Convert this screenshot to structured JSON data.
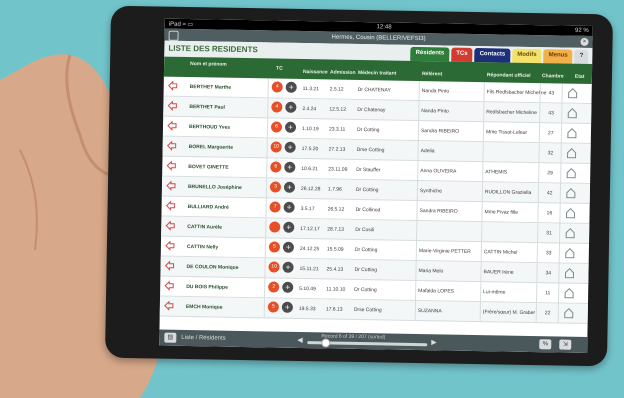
{
  "status": {
    "left": "iPad ≈ ▭",
    "time": "12:48",
    "battery": "92 %"
  },
  "app_title": "Hermes, Cousin (BELLERIVEFSI3)",
  "page_title": "LISTE DES RESIDENTS",
  "tabs": [
    "Résidents",
    "TCs",
    "Contacts",
    "Modifs",
    "Menus",
    "?"
  ],
  "columns": {
    "nom": "Nom et prénom",
    "tc": "TC",
    "naissance": "Naissance",
    "admission": "Admission",
    "medecin": "Médecin traitant",
    "referent": "Référent",
    "repondant": "Répondant officiel",
    "chambre": "Chambre",
    "etat": "Etat"
  },
  "rows": [
    {
      "nom": "BERTHET Marthe",
      "tc": "4",
      "naissance": "11.3.21",
      "admission": "2.5.12",
      "medecin": "Dr CHATENAY",
      "referent": "Nanda Pinto",
      "repondant": "Fils Redlsbacher Micheline",
      "chambre": "43"
    },
    {
      "nom": "BERTHET Paul",
      "tc": "4",
      "naissance": "2.4.24",
      "admission": "12.5.12",
      "medecin": "Dr Chatenay",
      "referent": "Nanda Pinto",
      "repondant": "Redlsbacher Micheline",
      "chambre": "43"
    },
    {
      "nom": "BERTHOUD Yves",
      "tc": "6",
      "naissance": "1.10.19",
      "admission": "23.3.11",
      "medecin": "Dr Cotting",
      "referent": "Sandra RIBEIRO",
      "repondant": "Mme Tissot-Leleur",
      "chambre": "27"
    },
    {
      "nom": "BOREL Marguerite",
      "tc": "10",
      "naissance": "17.5.20",
      "admission": "27.2.13",
      "medecin": "Drse Cotting",
      "referent": "Adelia",
      "repondant": "",
      "chambre": "32"
    },
    {
      "nom": "BOVET GINETTE",
      "tc": "6",
      "naissance": "10.6.21",
      "admission": "23.11.09",
      "medecin": "Dr Stauffer",
      "referent": "Anna OLIVEIRA",
      "repondant": "ATHEMIS",
      "chambre": "29"
    },
    {
      "nom": "BRUNELLO Joséphine",
      "tc": "3",
      "naissance": "26.12.28",
      "admission": "1.7.96",
      "medecin": "Dr Cotting",
      "referent": "Synthiche",
      "repondant": "RUDILLON Graziella",
      "chambre": "42"
    },
    {
      "nom": "BULLIARD André",
      "tc": "7",
      "naissance": "3.5.17",
      "admission": "26.5.12",
      "medecin": "Dr Collinod",
      "referent": "Sandra RIBEIRO",
      "repondant": "Mme Fivaz fille",
      "chambre": "16"
    },
    {
      "nom": "CATTIN Aurèle",
      "tc": "",
      "naissance": "17.12.17",
      "admission": "28.7.13",
      "medecin": "Dr Cosili",
      "referent": "",
      "repondant": "",
      "chambre": "31"
    },
    {
      "nom": "CATTIN Nelly",
      "tc": "5",
      "naissance": "24.12.25",
      "admission": "15.5.09",
      "medecin": "Dr Cotting",
      "referent": "Marie-Virginie PETTER",
      "repondant": "CATTIN Michel",
      "chambre": "33"
    },
    {
      "nom": "DE COULON Monique",
      "tc": "10",
      "naissance": "15.11.21",
      "admission": "25.4.13",
      "medecin": "Dr Cotting",
      "referent": "Maria Melo",
      "repondant": "BAUER Irène",
      "chambre": "34"
    },
    {
      "nom": "DU BOIS Philippe",
      "tc": "2",
      "naissance": "5.10.49",
      "admission": "11.10.10",
      "medecin": "Dr Cotting",
      "referent": "Mafalda LOPES",
      "repondant": "Lui-même",
      "chambre": "11"
    },
    {
      "nom": "EMCH Monique",
      "tc": "5",
      "naissance": "19.5.33",
      "admission": "17.6.13",
      "medecin": "Drse Cotting",
      "referent": "SUZANNA",
      "repondant": "(Frère/sœur) M. Graber",
      "chambre": "22"
    }
  ],
  "footer": {
    "list_label": "Liste / Résidents",
    "record": "Record 6 of 39 / 207 (sorted)"
  },
  "colors": {
    "screen_bg": "#ffffff",
    "header_green": "#2c6a35",
    "tc_orange": "#e74f26",
    "background": "#72c4cb"
  }
}
